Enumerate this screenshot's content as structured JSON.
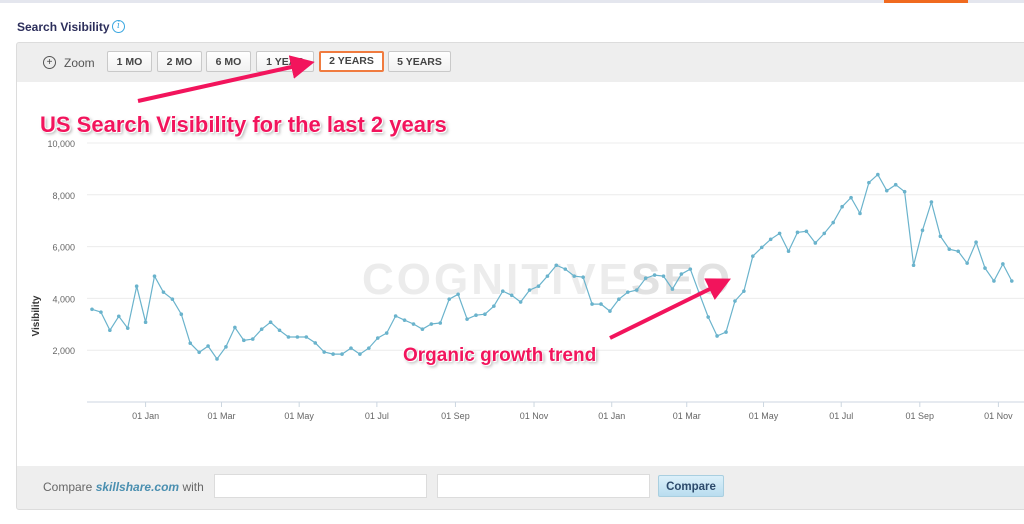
{
  "header": {
    "title": "Search Visibility",
    "info_icon": "info-icon"
  },
  "zoom": {
    "label": "Zoom",
    "icon": "zoom-in-icon",
    "buttons": [
      {
        "label": "1 MO",
        "active": false
      },
      {
        "label": "2 MO",
        "active": false
      },
      {
        "label": "6 MO",
        "active": false
      },
      {
        "label": "1 YEAR",
        "active": false
      },
      {
        "label": "2 YEARS",
        "active": true
      },
      {
        "label": "5 YEARS",
        "active": false
      }
    ]
  },
  "annotations": {
    "headline": "US Search Visibility for the last 2 years",
    "trend": "Organic growth trend",
    "color": "#f2145c"
  },
  "watermark": {
    "light": "COGNITIVE",
    "bold": "SEO"
  },
  "compare": {
    "prefix": "Compare",
    "domain": "skillshare.com",
    "suffix": "with",
    "input1_value": "",
    "input2_value": "",
    "button_label": "Compare"
  },
  "colors": {
    "line": "#6ab3cc",
    "active_button_border": "#f07b3f",
    "accent": "#f06a1f"
  },
  "chart_data": {
    "type": "line",
    "title": "",
    "xlabel": "",
    "ylabel": "Visibility",
    "ylim": [
      0,
      10000
    ],
    "yticks": [
      "2,000",
      "4,000",
      "6,000",
      "8,000",
      "10,000"
    ],
    "ytick_values": [
      2000,
      4000,
      6000,
      8000,
      10000
    ],
    "xtick_labels": [
      "01 Jan",
      "01 Mar",
      "01 May",
      "01 Jul",
      "01 Sep",
      "01 Nov",
      "01 Jan",
      "01 Mar",
      "01 May",
      "01 Jul",
      "01 Sep",
      "01 Nov"
    ],
    "xtick_weeks": [
      6.0,
      14.5,
      23.2,
      31.9,
      40.7,
      49.5,
      58.2,
      66.6,
      75.2,
      83.9,
      92.7,
      101.5
    ],
    "x_unit": "weekly points",
    "grid": true,
    "legend": "none",
    "series": [
      {
        "name": "Visibility",
        "values": [
          3580,
          3470,
          2770,
          3310,
          2850,
          4470,
          3080,
          4860,
          4240,
          3970,
          3390,
          2270,
          1920,
          2160,
          1660,
          2130,
          2880,
          2380,
          2430,
          2810,
          3080,
          2770,
          2510,
          2510,
          2510,
          2280,
          1930,
          1850,
          1850,
          2080,
          1850,
          2080,
          2470,
          2660,
          3320,
          3160,
          3010,
          2810,
          3010,
          3050,
          3970,
          4160,
          3200,
          3350,
          3390,
          3700,
          4280,
          4120,
          3860,
          4320,
          4470,
          4860,
          5280,
          5130,
          4860,
          4820,
          3780,
          3780,
          3510,
          3970,
          4240,
          4320,
          4780,
          4900,
          4860,
          4360,
          4940,
          5130,
          4200,
          3280,
          2550,
          2700,
          3900,
          4280,
          5630,
          5970,
          6280,
          6510,
          5820,
          6550,
          6590,
          6140,
          6510,
          6930,
          7540,
          7890,
          7280,
          8470,
          8780,
          8160,
          8390,
          8120,
          5280,
          6630,
          7720,
          6400,
          5900,
          5820,
          5360,
          6170,
          5170,
          4670,
          5330,
          4670
        ]
      }
    ]
  }
}
